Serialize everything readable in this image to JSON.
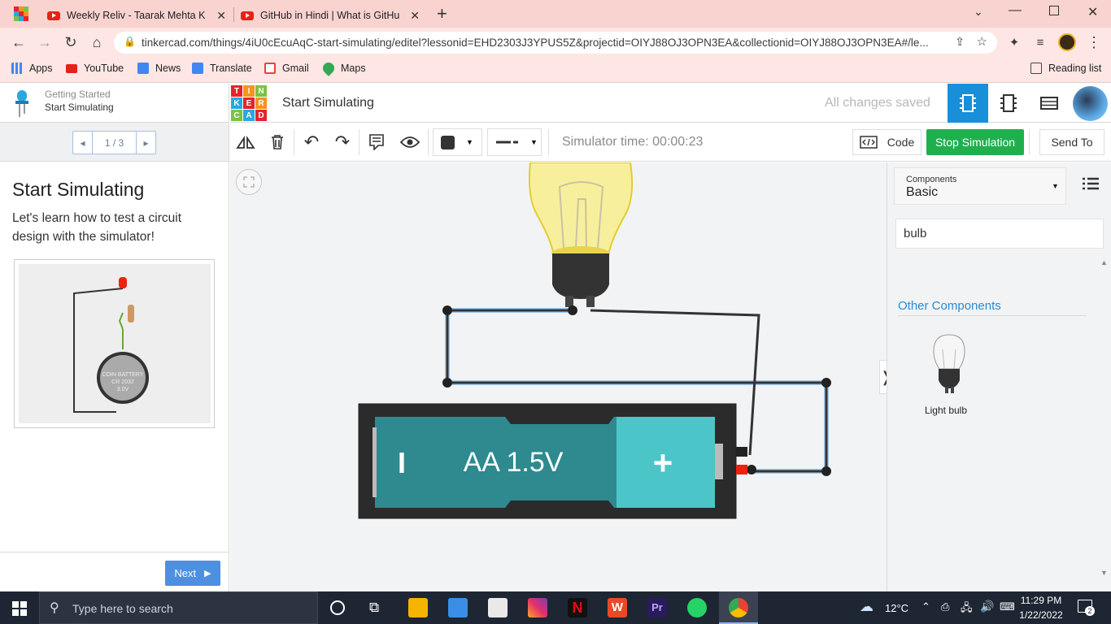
{
  "browser": {
    "tabs": [
      {
        "title": "Weekly Reliv - Taarak Mehta Ka C",
        "icon": "youtube-icon"
      },
      {
        "title": "GitHub in Hindi | What is GitHub",
        "icon": "youtube-icon"
      }
    ],
    "url": "tinkercad.com/things/4iU0cEcuAqC-start-simulating/editel?lessonid=EHD2303J3YPUS5Z&projectid=OIYJ88OJ3OPN3EA&collectionid=OIYJ88OJ3OPN3EA#/le...",
    "bookmarks": [
      {
        "label": "Apps",
        "icon": "apps-grid-icon"
      },
      {
        "label": "YouTube",
        "icon": "youtube-icon"
      },
      {
        "label": "News",
        "icon": "news-icon"
      },
      {
        "label": "Translate",
        "icon": "translate-icon"
      },
      {
        "label": "Gmail",
        "icon": "gmail-icon"
      },
      {
        "label": "Maps",
        "icon": "maps-icon"
      }
    ],
    "reading_list": "Reading list"
  },
  "lesson": {
    "breadcrumb_parent": "Getting Started",
    "breadcrumb_current": "Start Simulating",
    "pager": "1 / 3",
    "title": "Start Simulating",
    "description": "Let's learn how to test a circuit design with the simulator!",
    "next_label": "Next",
    "preview_battery_text": [
      "COIN BATTERY",
      "CR 2032",
      "3.0V"
    ]
  },
  "app": {
    "logo_letters": [
      "T",
      "I",
      "N",
      "K",
      "E",
      "R",
      "C",
      "A",
      "D"
    ],
    "logo_colors": [
      "#e2252c",
      "#f7931e",
      "#7bc243",
      "#29a8e0",
      "#e2252c",
      "#f7931e",
      "#7bc243",
      "#29a8e0",
      "#e2252c"
    ],
    "project_title": "Start Simulating",
    "save_status": "All changes saved"
  },
  "toolbar": {
    "simulator_time": "Simulator time: 00:00:23",
    "code_label": "Code",
    "stop_label": "Stop Simulation",
    "send_label": "Send To"
  },
  "circuit": {
    "battery_label": "AA 1.5V",
    "minus_symbol": "I",
    "plus_symbol": "+"
  },
  "components_panel": {
    "dropdown_caption": "Components",
    "dropdown_value": "Basic",
    "search_value": "bulb",
    "section_title": "Other Components",
    "items": [
      {
        "label": "Light bulb"
      }
    ]
  },
  "taskbar": {
    "search_placeholder": "Type here to search",
    "weather": "12°C",
    "time": "11:29 PM",
    "date": "1/22/2022",
    "notification_count": "2"
  },
  "colors": {
    "stop_button": "#1fb04d",
    "active_view": "#1a8fd9",
    "battery_teal": "#2e8a8f",
    "battery_plus": "#4cc5c8",
    "link_blue": "#2a8ad4"
  }
}
